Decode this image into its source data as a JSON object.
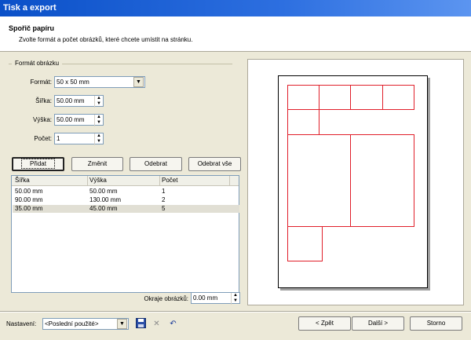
{
  "window": {
    "title": "Tisk a export"
  },
  "header": {
    "title": "Spořič papíru",
    "subtitle": "Zvolte formát a počet obrázků, které chcete umístit na stránku."
  },
  "format_group": {
    "legend": "Formát obrázku",
    "format_label": "Formát:",
    "format_value": "50 x 50 mm",
    "width_label": "Šířka:",
    "width_value": "50.00 mm",
    "height_label": "Výška:",
    "height_value": "50.00 mm",
    "count_label": "Počet:",
    "count_value": "1"
  },
  "buttons": {
    "add": "Přidat",
    "change": "Změnit",
    "remove": "Odebrat",
    "remove_all": "Odebrat vše"
  },
  "table": {
    "columns": [
      "Šířka",
      "Výška",
      "Počet"
    ],
    "rows": [
      [
        "50.00 mm",
        "50.00 mm",
        "1"
      ],
      [
        "90.00 mm",
        "130.00 mm",
        "2"
      ],
      [
        "35.00 mm",
        "45.00 mm",
        "5"
      ]
    ],
    "selected_row": 2
  },
  "margin": {
    "label": "Okraje obrázků:",
    "value": "0.00 mm"
  },
  "footer": {
    "settings_label": "Nastavení:",
    "settings_value": "<Poslední použité>",
    "back": "< Zpět",
    "next": "Další >",
    "cancel": "Storno"
  },
  "icons": {
    "save": "save-icon",
    "delete": "delete-icon",
    "undo": "undo-icon",
    "dropdown": "chevron-down-icon"
  },
  "colors": {
    "title_bar": "#0a50c8",
    "preview_cut_lines": "#e01f2a",
    "window_bg": "#ece9d8"
  }
}
